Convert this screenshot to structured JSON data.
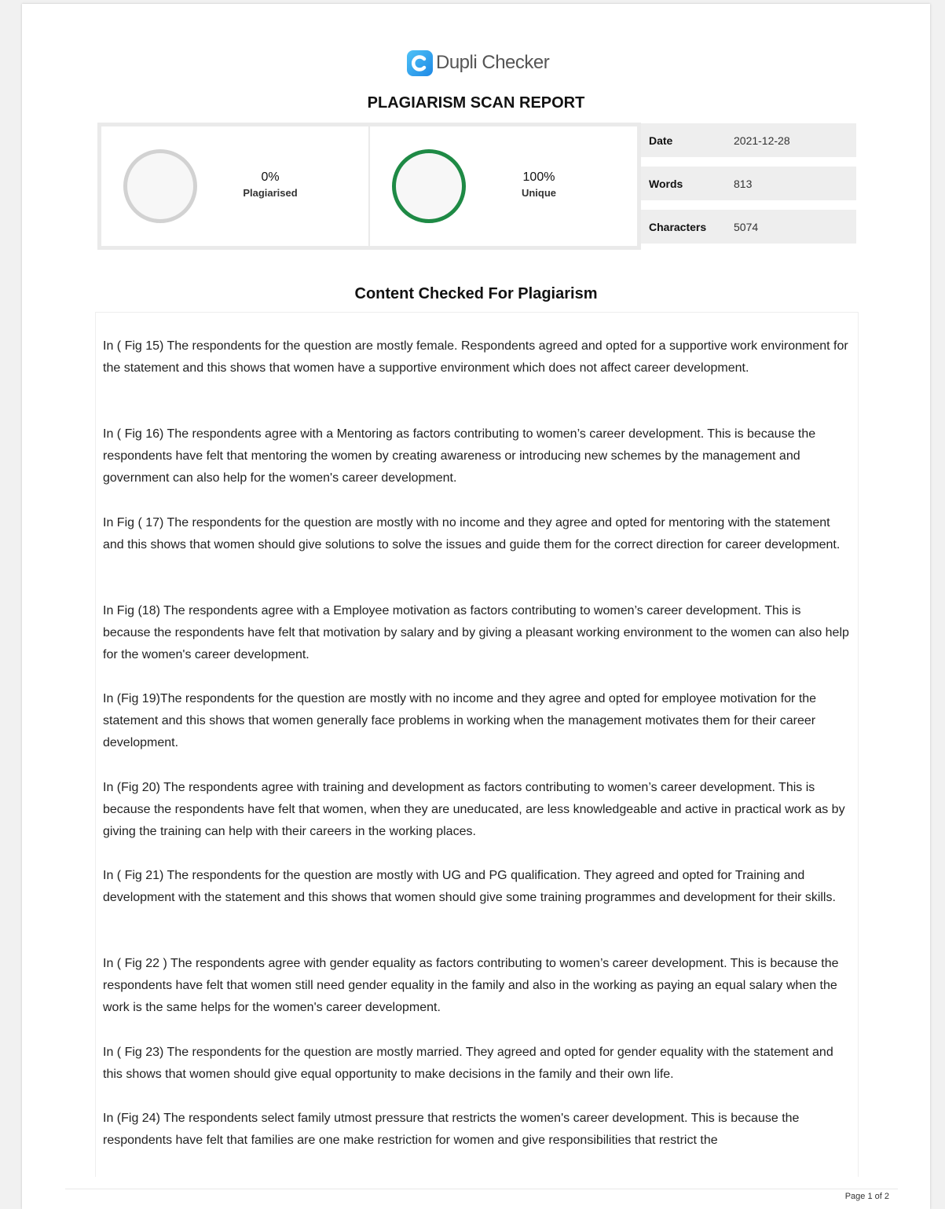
{
  "brand": {
    "name": "Dupli Checker",
    "logo_icon": "dupli-checker-c-logo",
    "accent": "#2196f3"
  },
  "report_title": "PLAGIARISM SCAN REPORT",
  "stats": {
    "plagiarised": {
      "value": "0%",
      "label": "Plagiarised",
      "fraction": 0.0,
      "ring_color": "#d2d2d2"
    },
    "unique": {
      "value": "100%",
      "label": "Unique",
      "fraction": 1.0,
      "ring_color": "#1e8a45"
    }
  },
  "meta": {
    "date": {
      "label": "Date",
      "value": "2021-12-28"
    },
    "words": {
      "label": "Words",
      "value": "813"
    },
    "characters": {
      "label": "Characters",
      "value": "5074"
    }
  },
  "content_title": "Content Checked For Plagiarism",
  "paragraphs": [
    "In   ( Fig 15) The respondents for the question are mostly female. Respondents agreed and opted for a supportive work environment for the statement and this shows that women  have a supportive environment which does not affect career development.",
    "In ( Fig 16) The  respondents agree with a Mentoring  as factors contributing to women’s career development. This is because the respondents have felt that mentoring the women by creating awareness or introducing new schemes by the management and government can also help for the women's career development.",
    "In Fig ( 17) The respondents for the question are mostly with no income and they agree and opted for mentoring with the statement and this shows that women  should give solutions to solve the issues and guide them for the correct direction for career development.",
    "In Fig (18) The  respondents agree with a Employee motivation  as factors contributing to women’s career development. This is because the respondents have felt that motivation by salary and by giving a pleasant working environment to the women  can also help for the women's career development.",
    "In (Fig 19)The respondents for the question are mostly with no income and they agree and opted for employee motivation for the statement and this shows that women  generally face problems in working when the management motivates them for their career development.",
    "In (Fig 20) The  respondents agree with training and development as factors contributing to women’s career development. This is because the respondents have felt that women, when they are uneducated, are less knowledgeable and active in practical work  as by giving the training can help with their careers in the working places.",
    "In ( Fig 21) The respondents for the question are mostly with  UG and PG qualification. They agreed and opted for Training and development  with the statement and this shows that women should give some training programmes and development for their skills.",
    "In ( Fig 22 ) The  respondents agree with gender equality as factors contributing to women’s career development. This is because the respondents have felt that women  still need gender equality in the family and also in the working as paying an equal salary when the work is the same helps for the women's career development.",
    " In ( Fig 23) The respondents for the question are mostly married. They agreed and opted for gender equality with the statement and this shows that women should give  equal opportunity to make decisions in the family and their own life.",
    "In (Fig 24) The  respondents select family utmost pressure that restricts the women's career development. This is because the respondents have felt that  families are one make restriction for women and give responsibilities that restrict the"
  ],
  "footer": {
    "page_label": "Page 1 of 2"
  }
}
